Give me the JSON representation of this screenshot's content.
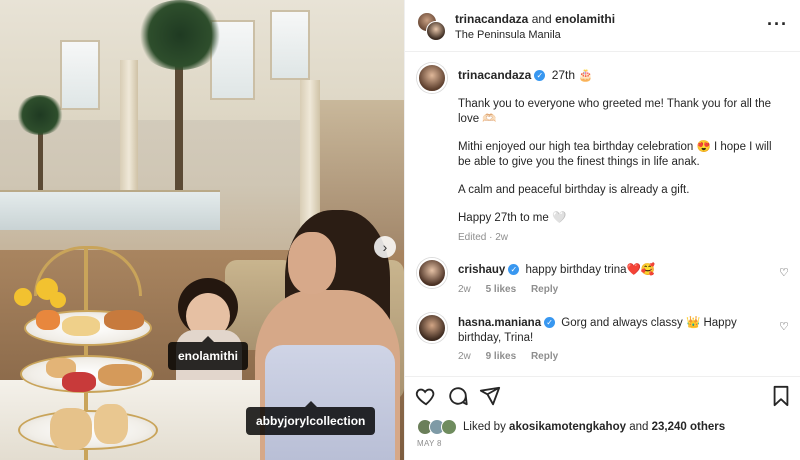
{
  "photo": {
    "tags": [
      "enolamithi",
      "abbyjorylcollection"
    ],
    "next_icon": "chevron-right-icon"
  },
  "header": {
    "user1": "trinacandaza",
    "connector": "and",
    "user2": "enolamithi",
    "location": "The Peninsula Manila",
    "more_icon": "more-horizontal-icon"
  },
  "caption": {
    "username": "trinacandaza",
    "extra": "27th",
    "extra_emoji": "🎂",
    "p1": "Thank you to everyone who greeted me! Thank you for all the love",
    "p1_emoji": "🫶🏻",
    "p2a": "Mithi enjoyed our high tea birthday celebration",
    "p2_emoji": "😍",
    "p2b": "I hope I will be able to give you the finest things in life anak.",
    "p3": "A calm and peaceful birthday is already a gift.",
    "p4": "Happy 27th to me",
    "p4_emoji": "🤍",
    "meta": "Edited · 2w"
  },
  "comments": [
    {
      "username": "crishauy",
      "text": "happy birthday trina",
      "emoji": "❤️🥰",
      "time": "2w",
      "likes": "5 likes",
      "reply": "Reply"
    },
    {
      "username": "hasna.maniana",
      "text_a": "Gorg and always classy",
      "emoji": "👑",
      "text_b": "Happy birthday, Trina!",
      "time": "2w",
      "likes": "9 likes",
      "reply": "Reply"
    }
  ],
  "actions": {
    "like_icon": "heart-icon",
    "comment_icon": "comment-icon",
    "share_icon": "send-icon",
    "save_icon": "bookmark-icon"
  },
  "likes": {
    "prefix": "Liked by",
    "user": "akosikamotengkahoy",
    "suffix": "and",
    "count": "23,240 others"
  },
  "date": "MAY 8"
}
